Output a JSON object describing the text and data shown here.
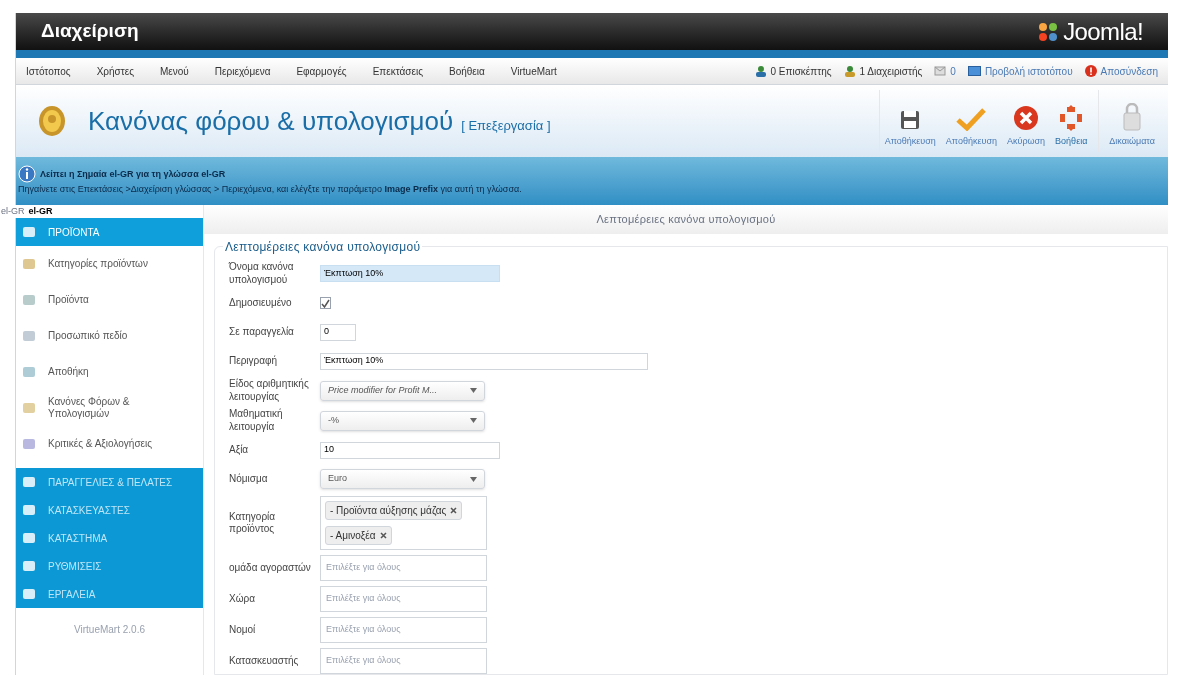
{
  "header": {
    "title": "Διαχείριση",
    "logo": "Joomla!"
  },
  "menu": [
    "Ιστότοπος",
    "Χρήστες",
    "Μενού",
    "Περιεχόμενα",
    "Εφαρμογές",
    "Επεκτάσεις",
    "Βοήθεια",
    "VirtueMart"
  ],
  "status": [
    {
      "kind": "visitors",
      "label": "0 Επισκέπτης"
    },
    {
      "kind": "admins",
      "label": "1 Διαχειριστής"
    },
    {
      "kind": "messages",
      "label": "0"
    },
    {
      "kind": "preview",
      "label": "Προβολή ιστοτόπου"
    },
    {
      "kind": "logout",
      "label": "Αποσύνδεση"
    }
  ],
  "page_title": {
    "title": "Κανόνας φόρου & υπολογισμού",
    "subtitle": "[ Επεξεργασία ]"
  },
  "toolbar": [
    {
      "kind": "save",
      "label": "Αποθήκευση"
    },
    {
      "kind": "apply",
      "label": "Αποθήκευση"
    },
    {
      "kind": "cancel",
      "label": "Ακύρωση"
    },
    {
      "kind": "help",
      "label": "Βοήθεια"
    },
    {
      "kind": "permissions",
      "label": "Δικαιώματα"
    }
  ],
  "notice": {
    "heading": "Λείπει η Σημαία el-GR για τη γλώσσα el-GR",
    "text": "Πηγαίνετε στις Επεκτάσεις >Διαχείριση γλώσσας > Περιεχόμενα, και ελέγξτε την παράμετρο **Image Prefix** για αυτή τη γλώσσα."
  },
  "language": {
    "code": "el-GR",
    "name": "el-GR"
  },
  "sidebar": {
    "items": [
      {
        "kind": "section",
        "label": "ΠΡΟΪΟΝΤΑ",
        "selected": true
      },
      {
        "kind": "item",
        "label": "Κατηγορίες προϊόντων",
        "selected": false
      },
      {
        "kind": "item",
        "label": "Προϊόντα",
        "selected": false
      },
      {
        "kind": "item",
        "label": "Προσωπικό πεδίο",
        "selected": false
      },
      {
        "kind": "item",
        "label": "Αποθήκη",
        "selected": false
      },
      {
        "kind": "item",
        "label": "Κανόνες Φόρων & Υπολογισμών",
        "selected": false
      },
      {
        "kind": "item",
        "label": "Κριτικές & Αξιολογήσεις",
        "selected": false
      },
      {
        "kind": "section",
        "label": "ΠΑΡΑΓΓΕΛΙΕΣ & ΠΕΛΑΤΕΣ",
        "selected": false
      },
      {
        "kind": "section",
        "label": "ΚΑΤΑΣΚΕΥΑΣΤΕΣ",
        "selected": false
      },
      {
        "kind": "section",
        "label": "ΚΑΤΑΣΤΗΜΑ",
        "selected": false
      },
      {
        "kind": "section",
        "label": "ΡΥΘΜΙΣΕΙΣ",
        "selected": false
      },
      {
        "kind": "section",
        "label": "ΕΡΓΑΛΕΙΑ",
        "selected": false
      }
    ],
    "footer": "VirtueMart 2.0.6"
  },
  "tab_title": "Λεπτομέρειες κανόνα υπολογισμού",
  "form": {
    "legend": "Λεπτομέρειες κανόνα υπολογισμού",
    "fields": [
      {
        "kind": "text",
        "label": "Όνομα κανόνα υπολογισμού",
        "value": "Έκπτωση 10%",
        "focused": true
      },
      {
        "kind": "checkbox",
        "label": "Δημοσιευμένο",
        "checked": true
      },
      {
        "kind": "text",
        "label": "Σε παραγγελία",
        "value": "0",
        "focused": false
      },
      {
        "kind": "text",
        "label": "Περιγραφή",
        "value": "Έκπτωση 10%",
        "focused": false
      },
      {
        "kind": "select",
        "label": "Είδος αριθμητικής λειτουργίας",
        "value": "Price modifier for Profit M..."
      },
      {
        "kind": "select",
        "label": "Μαθηματική λειτουργία",
        "value": "-%"
      },
      {
        "kind": "text",
        "label": "Αξία",
        "value": "10",
        "focused": false
      },
      {
        "kind": "select",
        "label": "Νόμισμα",
        "value": "Euro"
      },
      {
        "kind": "tags",
        "label": "Κατηγορία προϊόντος",
        "tags": [
          "- Προϊόντα αύξησης μάζας",
          "- Αμινοξέα"
        ]
      },
      {
        "kind": "multi",
        "label": "ομάδα αγοραστών",
        "placeholder": "Επιλέξτε για όλους"
      },
      {
        "kind": "multi",
        "label": "Χώρα",
        "placeholder": "Επιλέξτε για όλους"
      },
      {
        "kind": "multi",
        "label": "Νομοί",
        "placeholder": "Επιλέξτε για όλους"
      },
      {
        "kind": "multi",
        "label": "Κατασκευαστής",
        "placeholder": "Επιλέξτε για όλους"
      }
    ]
  }
}
